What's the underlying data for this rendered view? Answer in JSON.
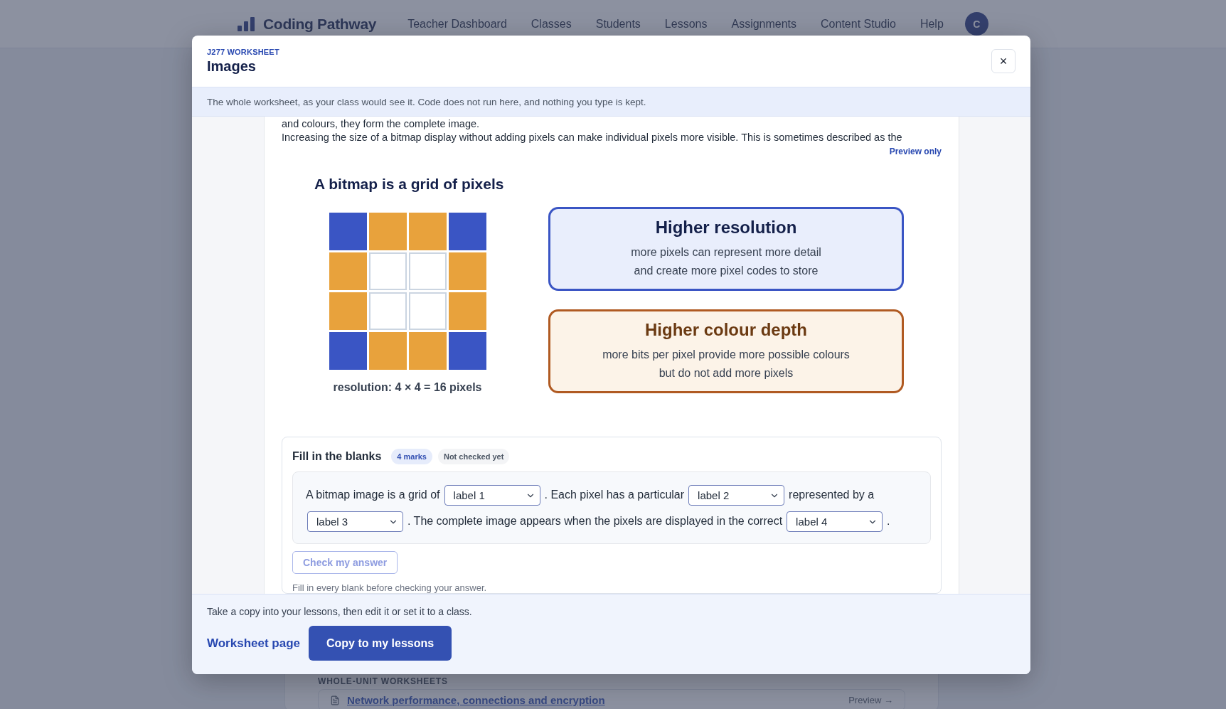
{
  "nav": {
    "brand": "Coding Pathway",
    "avatar": "C",
    "items": [
      {
        "label": "Teacher Dashboard"
      },
      {
        "label": "Classes"
      },
      {
        "label": "Students"
      },
      {
        "label": "Lessons"
      },
      {
        "label": "Assignments"
      },
      {
        "label": "Content Studio"
      },
      {
        "label": "Help"
      }
    ]
  },
  "background": {
    "section_heading": "WHOLE-UNIT WORKSHEETS",
    "rows": [
      {
        "title": "Network performance, connections and encryption",
        "action": "Preview →"
      }
    ]
  },
  "modal": {
    "eyebrow": "J277 WORKSHEET",
    "title": "Images",
    "close": "×",
    "notice": "The whole worksheet, as your class would see it. Code does not run here, and nothing you type is kept.",
    "passage": [
      "and colours, they form the complete image.",
      "Increasing the size of a bitmap display without adding pixels can make individual pixels more visible. This is sometimes described as the"
    ],
    "preview_label": "Preview only",
    "figure": {
      "title": "A bitmap is a grid of pixels",
      "caption": "resolution: 4 × 4 = 16 pixels",
      "grid": [
        [
          {
            "color": "#3a55c4"
          },
          {
            "color": "#e8a23c"
          },
          {
            "color": "#e8a23c"
          },
          {
            "color": "#3a55c4"
          }
        ],
        [
          {
            "color": "#e8a23c"
          },
          {
            "color": "#ffffff"
          },
          {
            "color": "#ffffff"
          },
          {
            "color": "#e8a23c"
          }
        ],
        [
          {
            "color": "#e8a23c"
          },
          {
            "color": "#ffffff"
          },
          {
            "color": "#ffffff"
          },
          {
            "color": "#e8a23c"
          }
        ],
        [
          {
            "color": "#3a55c4"
          },
          {
            "color": "#e8a23c"
          },
          {
            "color": "#e8a23c"
          },
          {
            "color": "#3a55c4"
          }
        ]
      ],
      "callouts": [
        {
          "kind": "resolution",
          "title": "Higher resolution",
          "lines": [
            "more pixels can represent more detail",
            "and create more pixel codes to store"
          ]
        },
        {
          "kind": "depth",
          "title": "Higher colour depth",
          "lines": [
            "more bits per pixel provide more possible colours",
            "but do not add more pixels"
          ]
        }
      ]
    },
    "exercise": {
      "title": "Fill in the blanks",
      "marks": "4 marks",
      "status": "Not checked yet",
      "sentence": [
        {
          "kind": "text",
          "text": "A bitmap image is a grid of"
        },
        {
          "kind": "blank",
          "value": "label 1"
        },
        {
          "kind": "text",
          "text": ". Each pixel has a particular"
        },
        {
          "kind": "blank",
          "value": "label 2"
        },
        {
          "kind": "text",
          "text": "represented by a"
        },
        {
          "kind": "blank",
          "value": "label 3"
        },
        {
          "kind": "text",
          "text": ". The complete image appears when the pixels are displayed in the correct"
        },
        {
          "kind": "blank",
          "value": "label 4"
        },
        {
          "kind": "text",
          "text": "."
        }
      ],
      "check_button": {
        "label": "Check my answer",
        "disabled": true
      },
      "hint": "Fill in every blank before checking your answer."
    },
    "footer": {
      "text": "Take a copy into your lessons, then edit it or set it to a class.",
      "link": "Worksheet page",
      "button": "Copy to my lessons"
    }
  }
}
